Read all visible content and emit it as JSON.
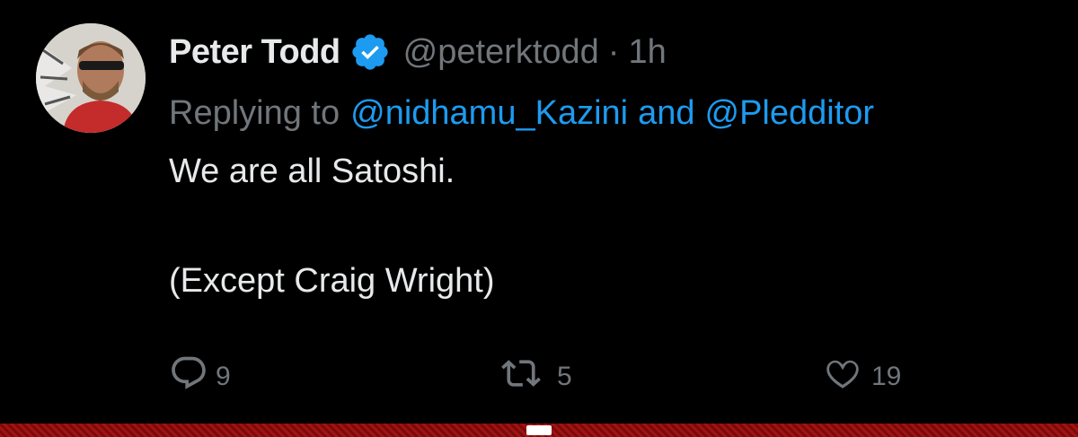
{
  "tweet": {
    "display_name": "Peter Todd",
    "handle": "@peterktodd",
    "separator": "·",
    "time": "1h",
    "replying_prefix": "Replying to",
    "reply_to_1": "@nidhamu_Kazini",
    "reply_conjunction": "and",
    "reply_to_2": "@Pledditor",
    "text_line_1": "We are all Satoshi.",
    "text_line_2": "(Except Craig Wright)"
  },
  "actions": {
    "replies": "9",
    "retweets": "5",
    "likes": "19"
  },
  "colors": {
    "background": "#000000",
    "text_primary": "#e7e9ea",
    "text_secondary": "#71767b",
    "link": "#1d9bf0",
    "verified_badge": "#1d9bf0",
    "bottom_bar": "#8a0c0c"
  },
  "icons": {
    "verified": "verified-badge-icon",
    "reply": "speech-bubble-icon",
    "retweet": "retweet-arrows-icon",
    "like": "heart-icon"
  }
}
